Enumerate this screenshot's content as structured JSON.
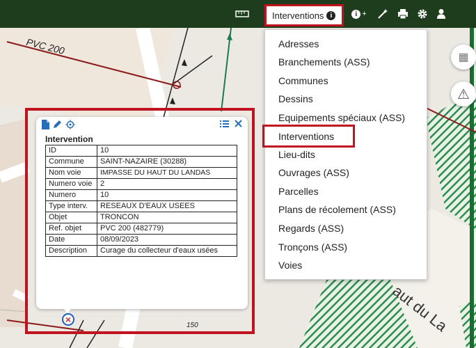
{
  "toolbar": {
    "interventions_label": "Interventions",
    "info_glyph": "i",
    "info_plus_label": "+"
  },
  "layer_menu": {
    "items": [
      {
        "label": "Adresses"
      },
      {
        "label": "Branchements (ASS)"
      },
      {
        "label": "Communes"
      },
      {
        "label": "Dessins"
      },
      {
        "label": "Equipements spéciaux (ASS)"
      },
      {
        "label": "Interventions",
        "highlighted": true
      },
      {
        "label": "Lieu-dits"
      },
      {
        "label": "Ouvrages (ASS)"
      },
      {
        "label": "Parcelles"
      },
      {
        "label": "Plans de récolement (ASS)"
      },
      {
        "label": "Regards (ASS)"
      },
      {
        "label": "Tronçons (ASS)"
      },
      {
        "label": "Voies"
      }
    ]
  },
  "map": {
    "pipe_label": "PVC 200",
    "street_label": "aut du La",
    "elevation_label": "150"
  },
  "popup": {
    "title": "Intervention",
    "rows": [
      {
        "key": "ID",
        "value": "10"
      },
      {
        "key": "Commune",
        "value": "SAINT-NAZAIRE (30288)"
      },
      {
        "key": "Nom voie",
        "value": "IMPASSE DU HAUT DU LANDAS"
      },
      {
        "key": "Numero voie",
        "value": "2"
      },
      {
        "key": "Numero",
        "value": "10"
      },
      {
        "key": "Type interv.",
        "value": "RESEAUX D'EAUX USEES"
      },
      {
        "key": "Objet",
        "value": "TRONCON"
      },
      {
        "key": "Ref. objet",
        "value": "PVC 200 (482779)"
      },
      {
        "key": "Date",
        "value": "08/09/2023"
      },
      {
        "key": "Description",
        "value": "Curage du collecteur d'eaux usées"
      }
    ]
  },
  "colors": {
    "toolbar_bg": "#1d3d1c",
    "highlight": "#c1121f",
    "link_blue": "#2a6db5",
    "pipe_red": "#8b1a1a",
    "park_green": "#2e8b4e"
  },
  "icons": [
    "ruler-icon",
    "info-circle-icon",
    "info-plus-icon",
    "magic-wand-icon",
    "printer-icon",
    "gear-icon",
    "user-icon",
    "snap-grid-icon",
    "warning-icon",
    "file-icon",
    "pencil-icon",
    "locate-icon",
    "list-icon",
    "close-icon",
    "intervention-marker-icon"
  ]
}
